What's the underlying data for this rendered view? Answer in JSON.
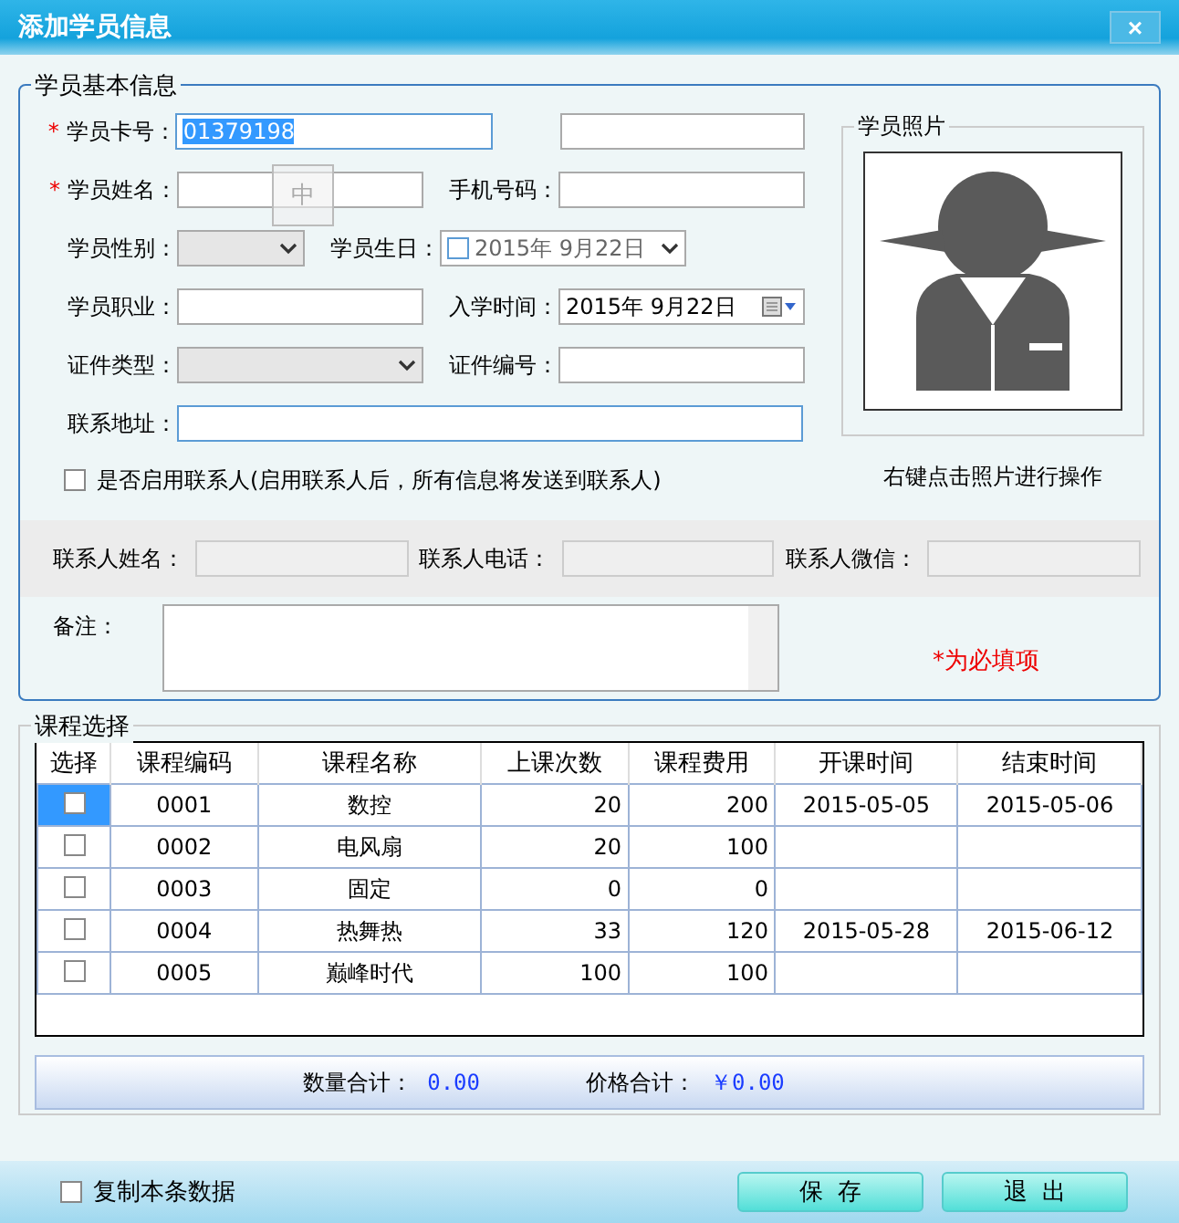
{
  "window": {
    "title": "添加学员信息",
    "close": "×"
  },
  "basic_info": {
    "legend": "学员基本信息",
    "rows": [
      [
        {
          "kind": "text",
          "label": "学员卡号：",
          "required_mark": "*",
          "value": "01379198",
          "focused": true
        },
        {
          "kind": "text",
          "focused": false
        }
      ],
      [
        {
          "kind": "text",
          "label": "学员姓名：",
          "required_mark": "*",
          "focused": false
        },
        {
          "kind": "text",
          "label": "手机号码：",
          "focused": false
        }
      ],
      [
        {
          "kind": "select",
          "label": "学员性别："
        },
        {
          "kind": "date",
          "label": "学员生日：",
          "value": "2015年  9月22日",
          "checked": false
        }
      ],
      [
        {
          "kind": "text",
          "label": "学员职业：",
          "focused": false
        },
        {
          "kind": "calendar",
          "label": "入学时间：",
          "value": "2015年  9月22日"
        }
      ],
      [
        {
          "kind": "select",
          "label": "证件类型："
        },
        {
          "kind": "text",
          "label": "证件编号：",
          "focused": false
        }
      ],
      [
        {
          "kind": "wide",
          "label": "联系地址："
        }
      ]
    ],
    "ime_indicator": "中",
    "photo": {
      "legend": "学员照片",
      "hint": "右键点击照片进行操作"
    },
    "contact_toggle": {
      "label": "是否启用联系人(启用联系人后，所有信息将发送到联系人)",
      "checked": false
    },
    "contact_fields": [
      {
        "label": "联系人姓名：",
        "disabled": true
      },
      {
        "label": "联系人电话：",
        "disabled": true
      },
      {
        "label": "联系人微信：",
        "disabled": true
      }
    ],
    "remarks": {
      "label": "备注："
    },
    "required_note": "*为必填项"
  },
  "courses": {
    "legend": "课程选择",
    "columns": [
      "选择",
      "课程编码",
      "课程名称",
      "上课次数",
      "课程费用",
      "开课时间",
      "结束时间"
    ],
    "rows": [
      {
        "checked": false,
        "selected": true,
        "code": "0001",
        "name": "数控",
        "sessions": "20",
        "fee": "200",
        "start": "2015-05-05",
        "end": "2015-05-06"
      },
      {
        "checked": false,
        "selected": false,
        "code": "0002",
        "name": "电风扇",
        "sessions": "20",
        "fee": "100",
        "start": "",
        "end": ""
      },
      {
        "checked": false,
        "selected": false,
        "code": "0003",
        "name": "固定",
        "sessions": "0",
        "fee": "0",
        "start": "",
        "end": ""
      },
      {
        "checked": false,
        "selected": false,
        "code": "0004",
        "name": "热舞热",
        "sessions": "33",
        "fee": "120",
        "start": "2015-05-28",
        "end": "2015-06-12"
      },
      {
        "checked": false,
        "selected": false,
        "code": "0005",
        "name": "巅峰时代",
        "sessions": "100",
        "fee": "100",
        "start": "",
        "end": ""
      }
    ],
    "totals": [
      {
        "label": "数量合计：",
        "value": "0.00"
      },
      {
        "label": "价格合计：",
        "value": "￥0.00"
      }
    ]
  },
  "footer": {
    "copy_toggle": {
      "label": "复制本条数据",
      "checked": false
    },
    "buttons": [
      "保  存",
      "退  出"
    ]
  }
}
